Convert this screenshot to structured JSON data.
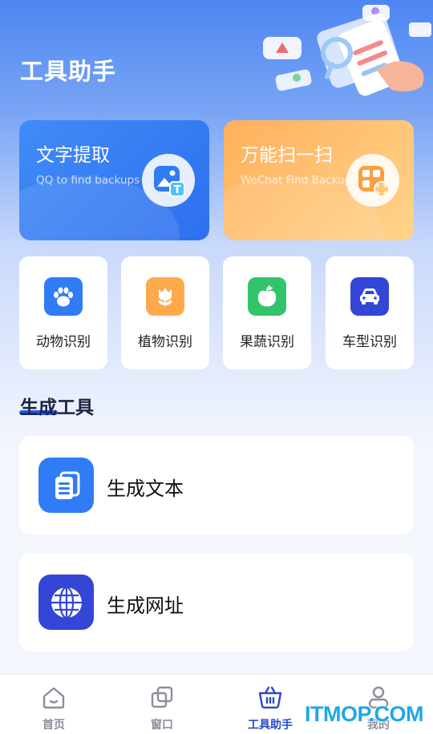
{
  "header": {
    "title": "工具助手"
  },
  "feature_cards": [
    {
      "title": "文字提取",
      "subtitle": "QQ to find backups",
      "icon": "image-text-icon"
    },
    {
      "title": "万能扫一扫",
      "subtitle": "WeChat Find Backups",
      "icon": "qr-scan-icon"
    }
  ],
  "recognition": [
    {
      "label": "动物识别",
      "icon": "paw-icon",
      "color": "#2f7cf6"
    },
    {
      "label": "植物识别",
      "icon": "tulip-icon",
      "color": "#ffa94d"
    },
    {
      "label": "果蔬识别",
      "icon": "apple-icon",
      "color": "#33c46b"
    },
    {
      "label": "车型识别",
      "icon": "car-icon",
      "color": "#3446d6"
    }
  ],
  "section": {
    "title": "生成工具"
  },
  "tools": [
    {
      "label": "生成文本",
      "icon": "document-icon",
      "color": "#2f7cf6"
    },
    {
      "label": "生成网址",
      "icon": "globe-icon",
      "color": "#3446d6"
    }
  ],
  "tabbar": {
    "items": [
      {
        "label": "首页",
        "icon": "home-icon"
      },
      {
        "label": "窗口",
        "icon": "windows-icon"
      },
      {
        "label": "工具助手",
        "icon": "basket-icon",
        "active": true
      },
      {
        "label": "我的",
        "icon": "person-icon"
      }
    ],
    "active_color": "#2a48cc"
  },
  "watermark": "ITMOP.COM"
}
